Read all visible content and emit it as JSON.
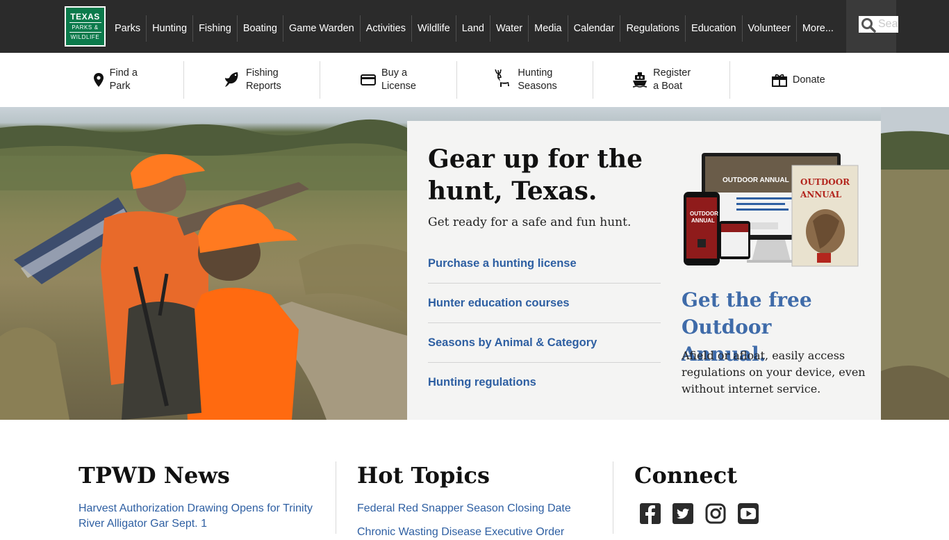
{
  "brand": {
    "logo_line1": "TEXAS",
    "logo_line2": "PARKS &",
    "logo_line3": "WILDLIFE",
    "green": "#0b7a4b"
  },
  "nav": {
    "items": [
      "Parks",
      "Hunting",
      "Fishing",
      "Boating",
      "Game Warden",
      "Activities",
      "Wildlife",
      "Land",
      "Water",
      "Media",
      "Calendar",
      "Regulations",
      "Education",
      "Volunteer",
      "More..."
    ]
  },
  "search": {
    "placeholder": "Search"
  },
  "quicklinks": [
    {
      "line1": "Find a",
      "line2": "Park",
      "icon": "map-pin-icon"
    },
    {
      "line1": "Fishing",
      "line2": "Reports",
      "icon": "fish-icon"
    },
    {
      "line1": "Buy a",
      "line2": "License",
      "icon": "credit-card-icon"
    },
    {
      "line1": "Hunting",
      "line2": "Seasons",
      "icon": "deer-icon"
    },
    {
      "line1": "Register",
      "line2": "a Boat",
      "icon": "boat-icon"
    },
    {
      "line1": "Donate",
      "line2": "",
      "icon": "gift-icon"
    }
  ],
  "hero": {
    "title": "Gear up for the hunt, Texas.",
    "subtitle": "Get ready for a safe and fun hunt.",
    "links": [
      "Purchase a hunting license",
      "Hunter education courses",
      "Seasons by Animal & Category",
      "Hunting regulations"
    ],
    "promo_title": "Get the free Outdoor Annual.",
    "promo_text": "Afield or afloat, easily access regulations on your device, even without internet service.",
    "device_label": "OUTDOOR ANNUAL",
    "phone_label_1": "OUTDOOR",
    "phone_label_2": "ANNUAL",
    "book_label_1": "OUTDOOR",
    "book_label_2": "ANNUAL",
    "link_color": "#2e5fa2",
    "promo_color": "#3f6ba9"
  },
  "news": {
    "title": "TPWD News",
    "item1": "Harvest Authorization Drawing Opens for Trinity River Alligator Gar Sept. 1"
  },
  "hot": {
    "title": "Hot Topics",
    "item1": "Federal Red Snapper Season Closing Date",
    "item2": "Chronic Wasting Disease Executive Order"
  },
  "connect": {
    "title": "Connect",
    "icons": [
      "facebook-icon",
      "twitter-icon",
      "instagram-icon",
      "youtube-icon"
    ]
  }
}
